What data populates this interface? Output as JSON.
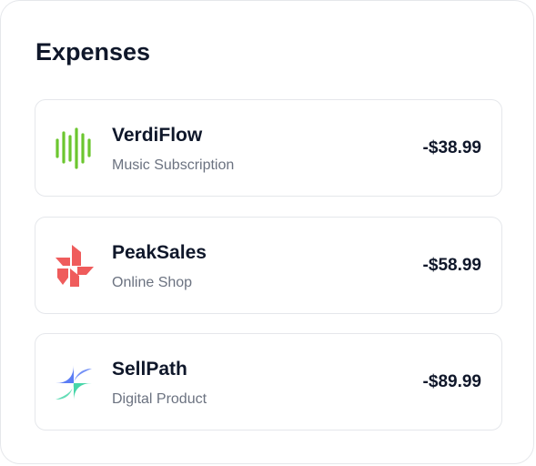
{
  "card": {
    "title": "Expenses"
  },
  "expenses": [
    {
      "name": "VerdiFlow",
      "subtitle": "Music Subscription",
      "amount": "-$38.99",
      "icon": "soundwave-logo-icon",
      "color": "#6cc62f"
    },
    {
      "name": "PeakSales",
      "subtitle": "Online Shop",
      "amount": "-$58.99",
      "icon": "pinwheel-logo-icon",
      "color": "#ef5c5c"
    },
    {
      "name": "SellPath",
      "subtitle": "Digital Product",
      "amount": "-$89.99",
      "icon": "sparkle-logo-icon",
      "colors": [
        "#5b7df5",
        "#48d6a9"
      ]
    }
  ]
}
